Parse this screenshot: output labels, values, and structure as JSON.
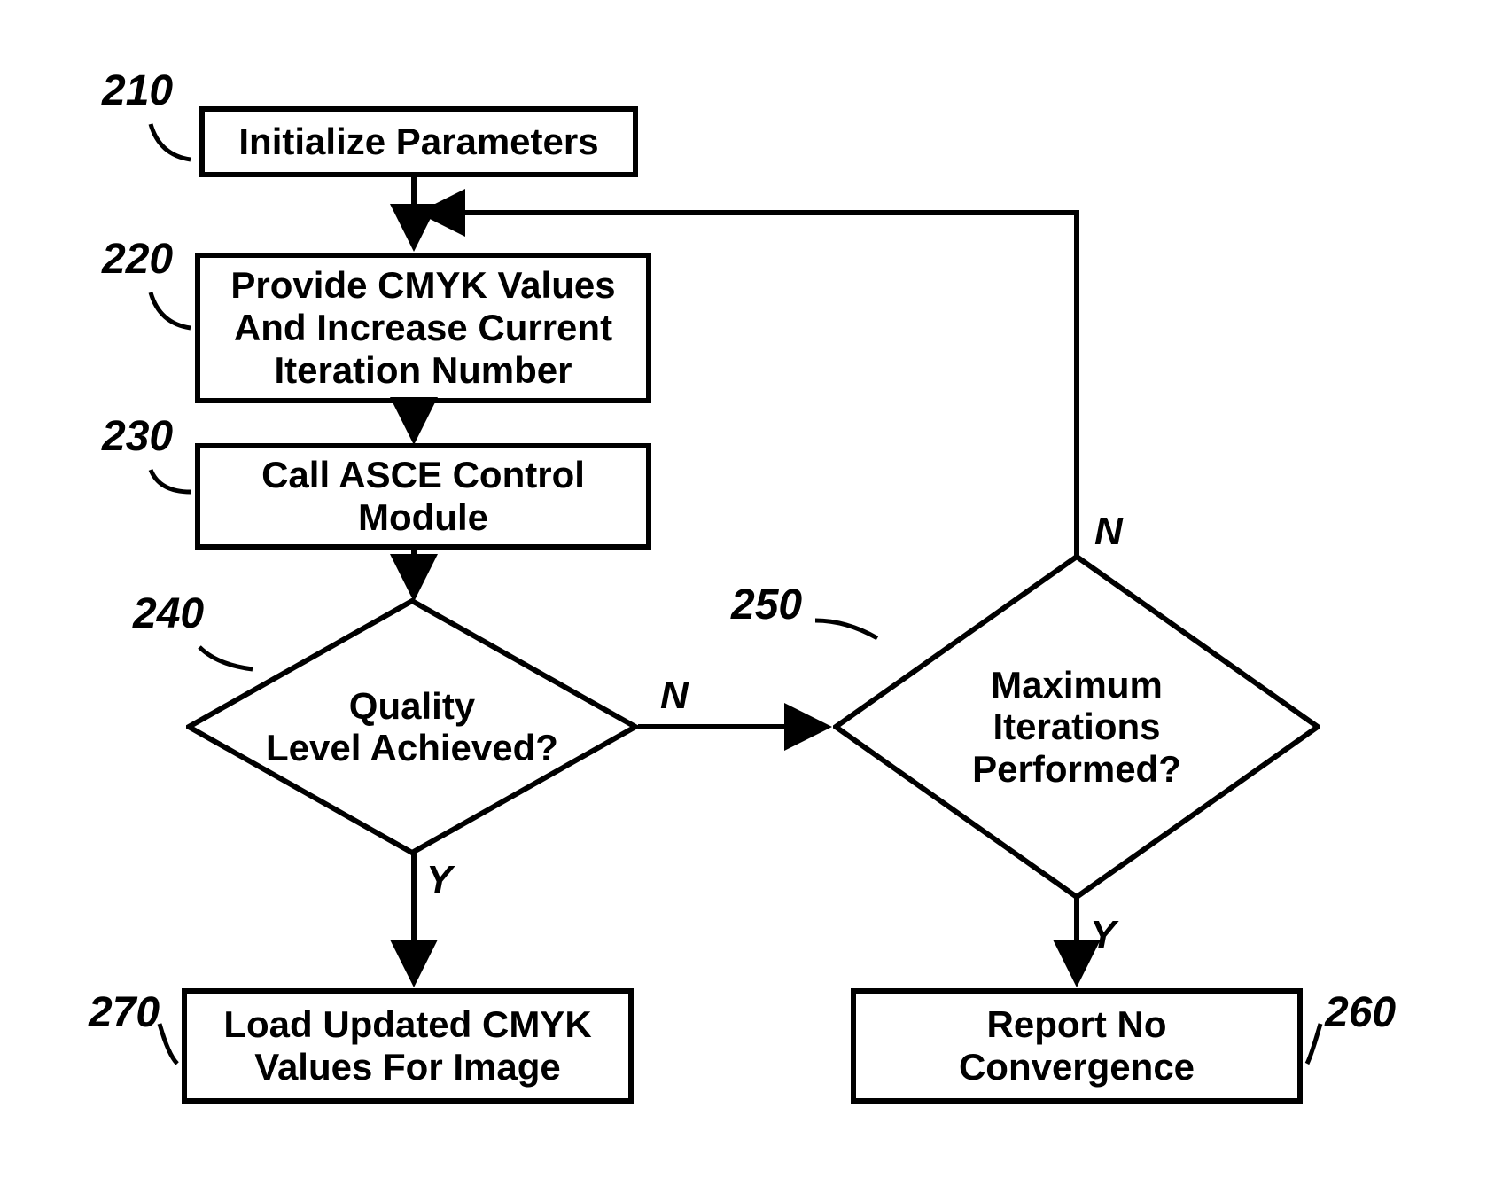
{
  "nodes": {
    "n210": {
      "ref": "210",
      "text": "Initialize Parameters"
    },
    "n220": {
      "ref": "220",
      "text": "Provide CMYK Values\nAnd Increase Current\nIteration Number"
    },
    "n230": {
      "ref": "230",
      "text": "Call ASCE Control\nModule"
    },
    "n240": {
      "ref": "240",
      "text": "Quality\nLevel Achieved?"
    },
    "n250": {
      "ref": "250",
      "text": "Maximum\nIterations\nPerformed?"
    },
    "n260": {
      "ref": "260",
      "text": "Report No\nConvergence"
    },
    "n270": {
      "ref": "270",
      "text": "Load Updated CMYK\nValues For Image"
    }
  },
  "edge_labels": {
    "q_yes": "Y",
    "q_no": "N",
    "m_yes": "Y",
    "m_no": "N"
  },
  "flow": [
    {
      "from": "n210",
      "to": "n220"
    },
    {
      "from": "n220",
      "to": "n230"
    },
    {
      "from": "n230",
      "to": "n240"
    },
    {
      "from": "n240",
      "to": "n270",
      "cond": "Y"
    },
    {
      "from": "n240",
      "to": "n250",
      "cond": "N"
    },
    {
      "from": "n250",
      "to": "n260",
      "cond": "Y"
    },
    {
      "from": "n250",
      "to": "n220",
      "cond": "N"
    }
  ]
}
